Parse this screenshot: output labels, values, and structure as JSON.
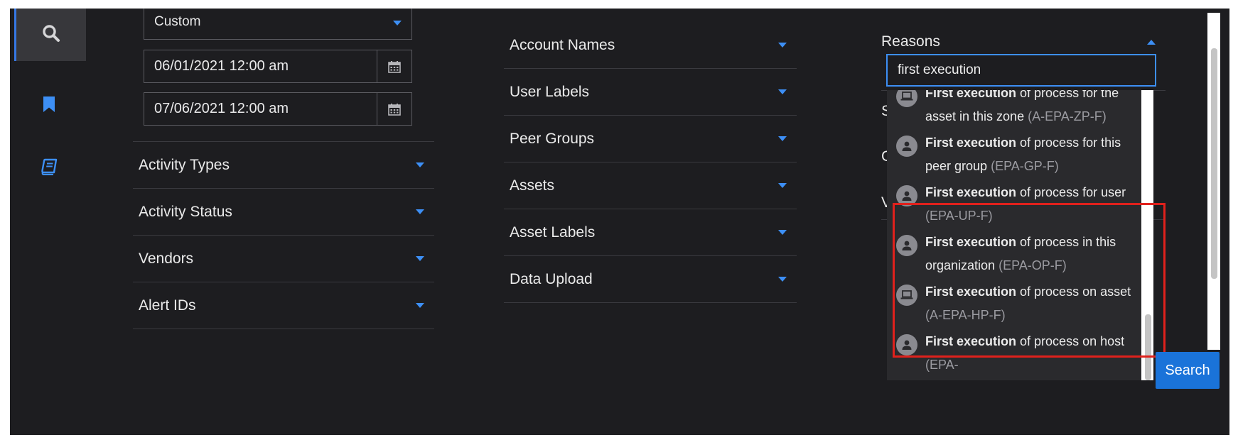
{
  "sidebar": {
    "items": [
      {
        "icon": "search-icon"
      },
      {
        "icon": "bookmark-icon"
      },
      {
        "icon": "book-icon"
      }
    ]
  },
  "time_filter": {
    "range_value": "Custom",
    "start_value": "06/01/2021 12:00 am",
    "end_value": "07/06/2021 12:00 am"
  },
  "column1": {
    "filters": [
      "Activity Types",
      "Activity Status",
      "Vendors",
      "Alert IDs"
    ]
  },
  "column2": {
    "filters": [
      "Account Names",
      "User Labels",
      "Peer Groups",
      "Assets",
      "Asset Labels",
      "Data Upload"
    ]
  },
  "reasons": {
    "label": "Reasons",
    "search_value": "first execution",
    "hidden_row_initials": [
      "S",
      "G",
      "V"
    ],
    "options": [
      {
        "icon": "laptop-icon",
        "bold": "First execution",
        "rest": " of process for the asset in this zone",
        "code": "(A-EPA-ZP-F)"
      },
      {
        "icon": "user-icon",
        "bold": "First execution",
        "rest": " of process for this peer group",
        "code": "(EPA-GP-F)"
      },
      {
        "icon": "user-icon",
        "bold": "First execution",
        "rest": " of process for user",
        "code": "(EPA-UP-F)"
      },
      {
        "icon": "user-icon",
        "bold": "First execution",
        "rest": " of process in this organization",
        "code": "(EPA-OP-F)"
      },
      {
        "icon": "laptop-icon",
        "bold": "First execution",
        "rest": " of process on asset",
        "code": "(A-EPA-HP-F)"
      },
      {
        "icon": "user-icon",
        "bold": "First execution",
        "rest": " of process on host",
        "code": "(EPA-"
      }
    ]
  },
  "actions": {
    "search_label": "Search"
  },
  "colors": {
    "accent": "#3d8ff5",
    "button": "#1a73d9",
    "highlight": "#e0211c",
    "background": "#1d1d20"
  }
}
